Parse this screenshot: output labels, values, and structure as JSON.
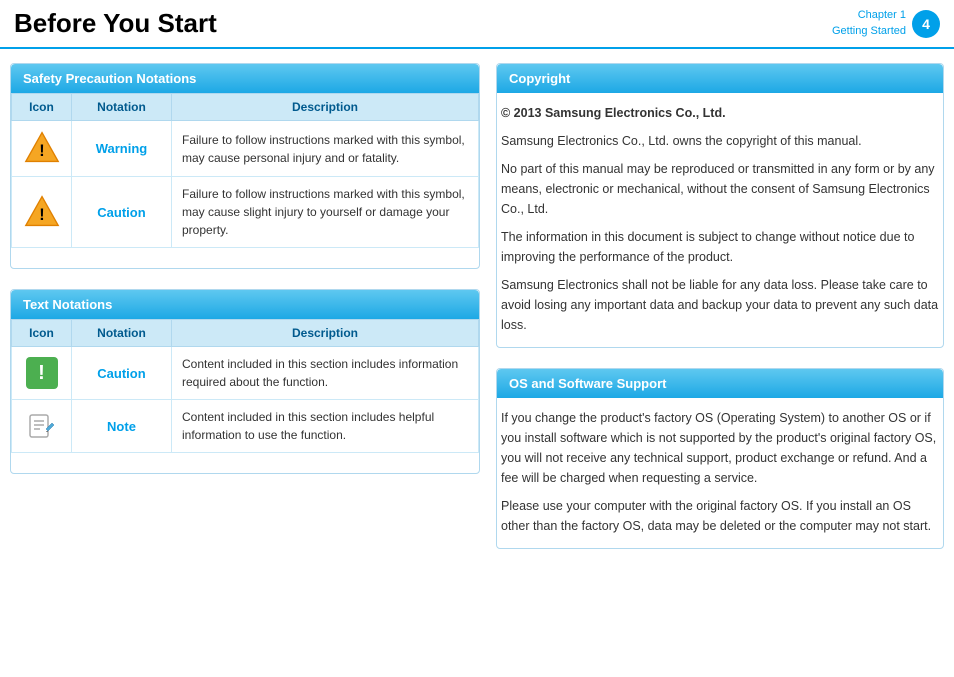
{
  "header": {
    "title": "Before You Start",
    "chapter_line1": "Chapter 1",
    "chapter_line2": "Getting Started",
    "page_number": "4"
  },
  "left": {
    "safety_section": {
      "title": "Safety Precaution Notations",
      "table": {
        "headers": [
          "Icon",
          "Notation",
          "Description"
        ],
        "rows": [
          {
            "icon_type": "warning-triangle",
            "notation": "Warning",
            "description": "Failure to follow instructions marked with this symbol, may cause personal injury and or fatality."
          },
          {
            "icon_type": "caution-triangle",
            "notation": "Caution",
            "description": "Failure to follow instructions marked with this symbol, may cause slight injury to yourself or damage your property."
          }
        ]
      }
    },
    "text_section": {
      "title": "Text Notations",
      "table": {
        "headers": [
          "Icon",
          "Notation",
          "Description"
        ],
        "rows": [
          {
            "icon_type": "caution-green",
            "notation": "Caution",
            "description": "Content included in this section includes information required about the function."
          },
          {
            "icon_type": "note-pencil",
            "notation": "Note",
            "description": "Content included in this section includes helpful information to use the function."
          }
        ]
      }
    }
  },
  "right": {
    "copyright_section": {
      "title": "Copyright",
      "paragraphs": [
        "© 2013 Samsung Electronics Co., Ltd.",
        "Samsung Electronics Co., Ltd. owns the copyright of this manual.",
        "No part of this manual may be reproduced or transmitted in any form or by any means, electronic or mechanical, without the consent of Samsung Electronics Co., Ltd.",
        "The information in this document is subject to change without notice due to improving the performance of the product.",
        "Samsung Electronics shall not be liable for any data loss. Please take care to avoid losing any important data and backup your data to prevent any such data loss."
      ]
    },
    "os_section": {
      "title": "OS and Software Support",
      "paragraphs": [
        "If you change the product's factory OS (Operating System) to another OS or if you install software which is not supported by the product's original factory OS, you will not receive any technical support, product exchange or refund. And a fee will be charged when requesting a service.",
        "Please use your computer with the original factory OS. If you install an OS other than the factory OS, data may be deleted or the computer may not start."
      ]
    }
  }
}
